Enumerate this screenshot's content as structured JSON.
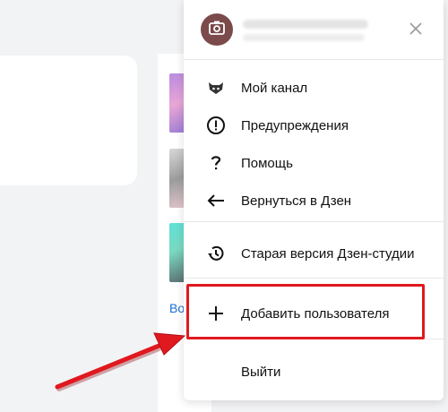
{
  "background": {
    "link_text": "Во"
  },
  "menu": {
    "header": {
      "avatar_icon": "camera-icon",
      "close_icon": "close-icon"
    },
    "items": [
      {
        "label": "Мой канал",
        "icon": "channel-avatar-icon"
      },
      {
        "label": "Предупреждения",
        "icon": "warning-icon"
      },
      {
        "label": "Помощь",
        "icon": "help-icon"
      },
      {
        "label": "Вернуться в Дзен",
        "icon": "arrow-left-icon"
      },
      {
        "label": "Старая версия Дзен-студии",
        "icon": "history-icon"
      },
      {
        "label": "Добавить пользователя",
        "icon": "plus-icon"
      },
      {
        "label": "Выйти",
        "icon": ""
      }
    ]
  },
  "annotation": {
    "color": "#e0191f"
  }
}
